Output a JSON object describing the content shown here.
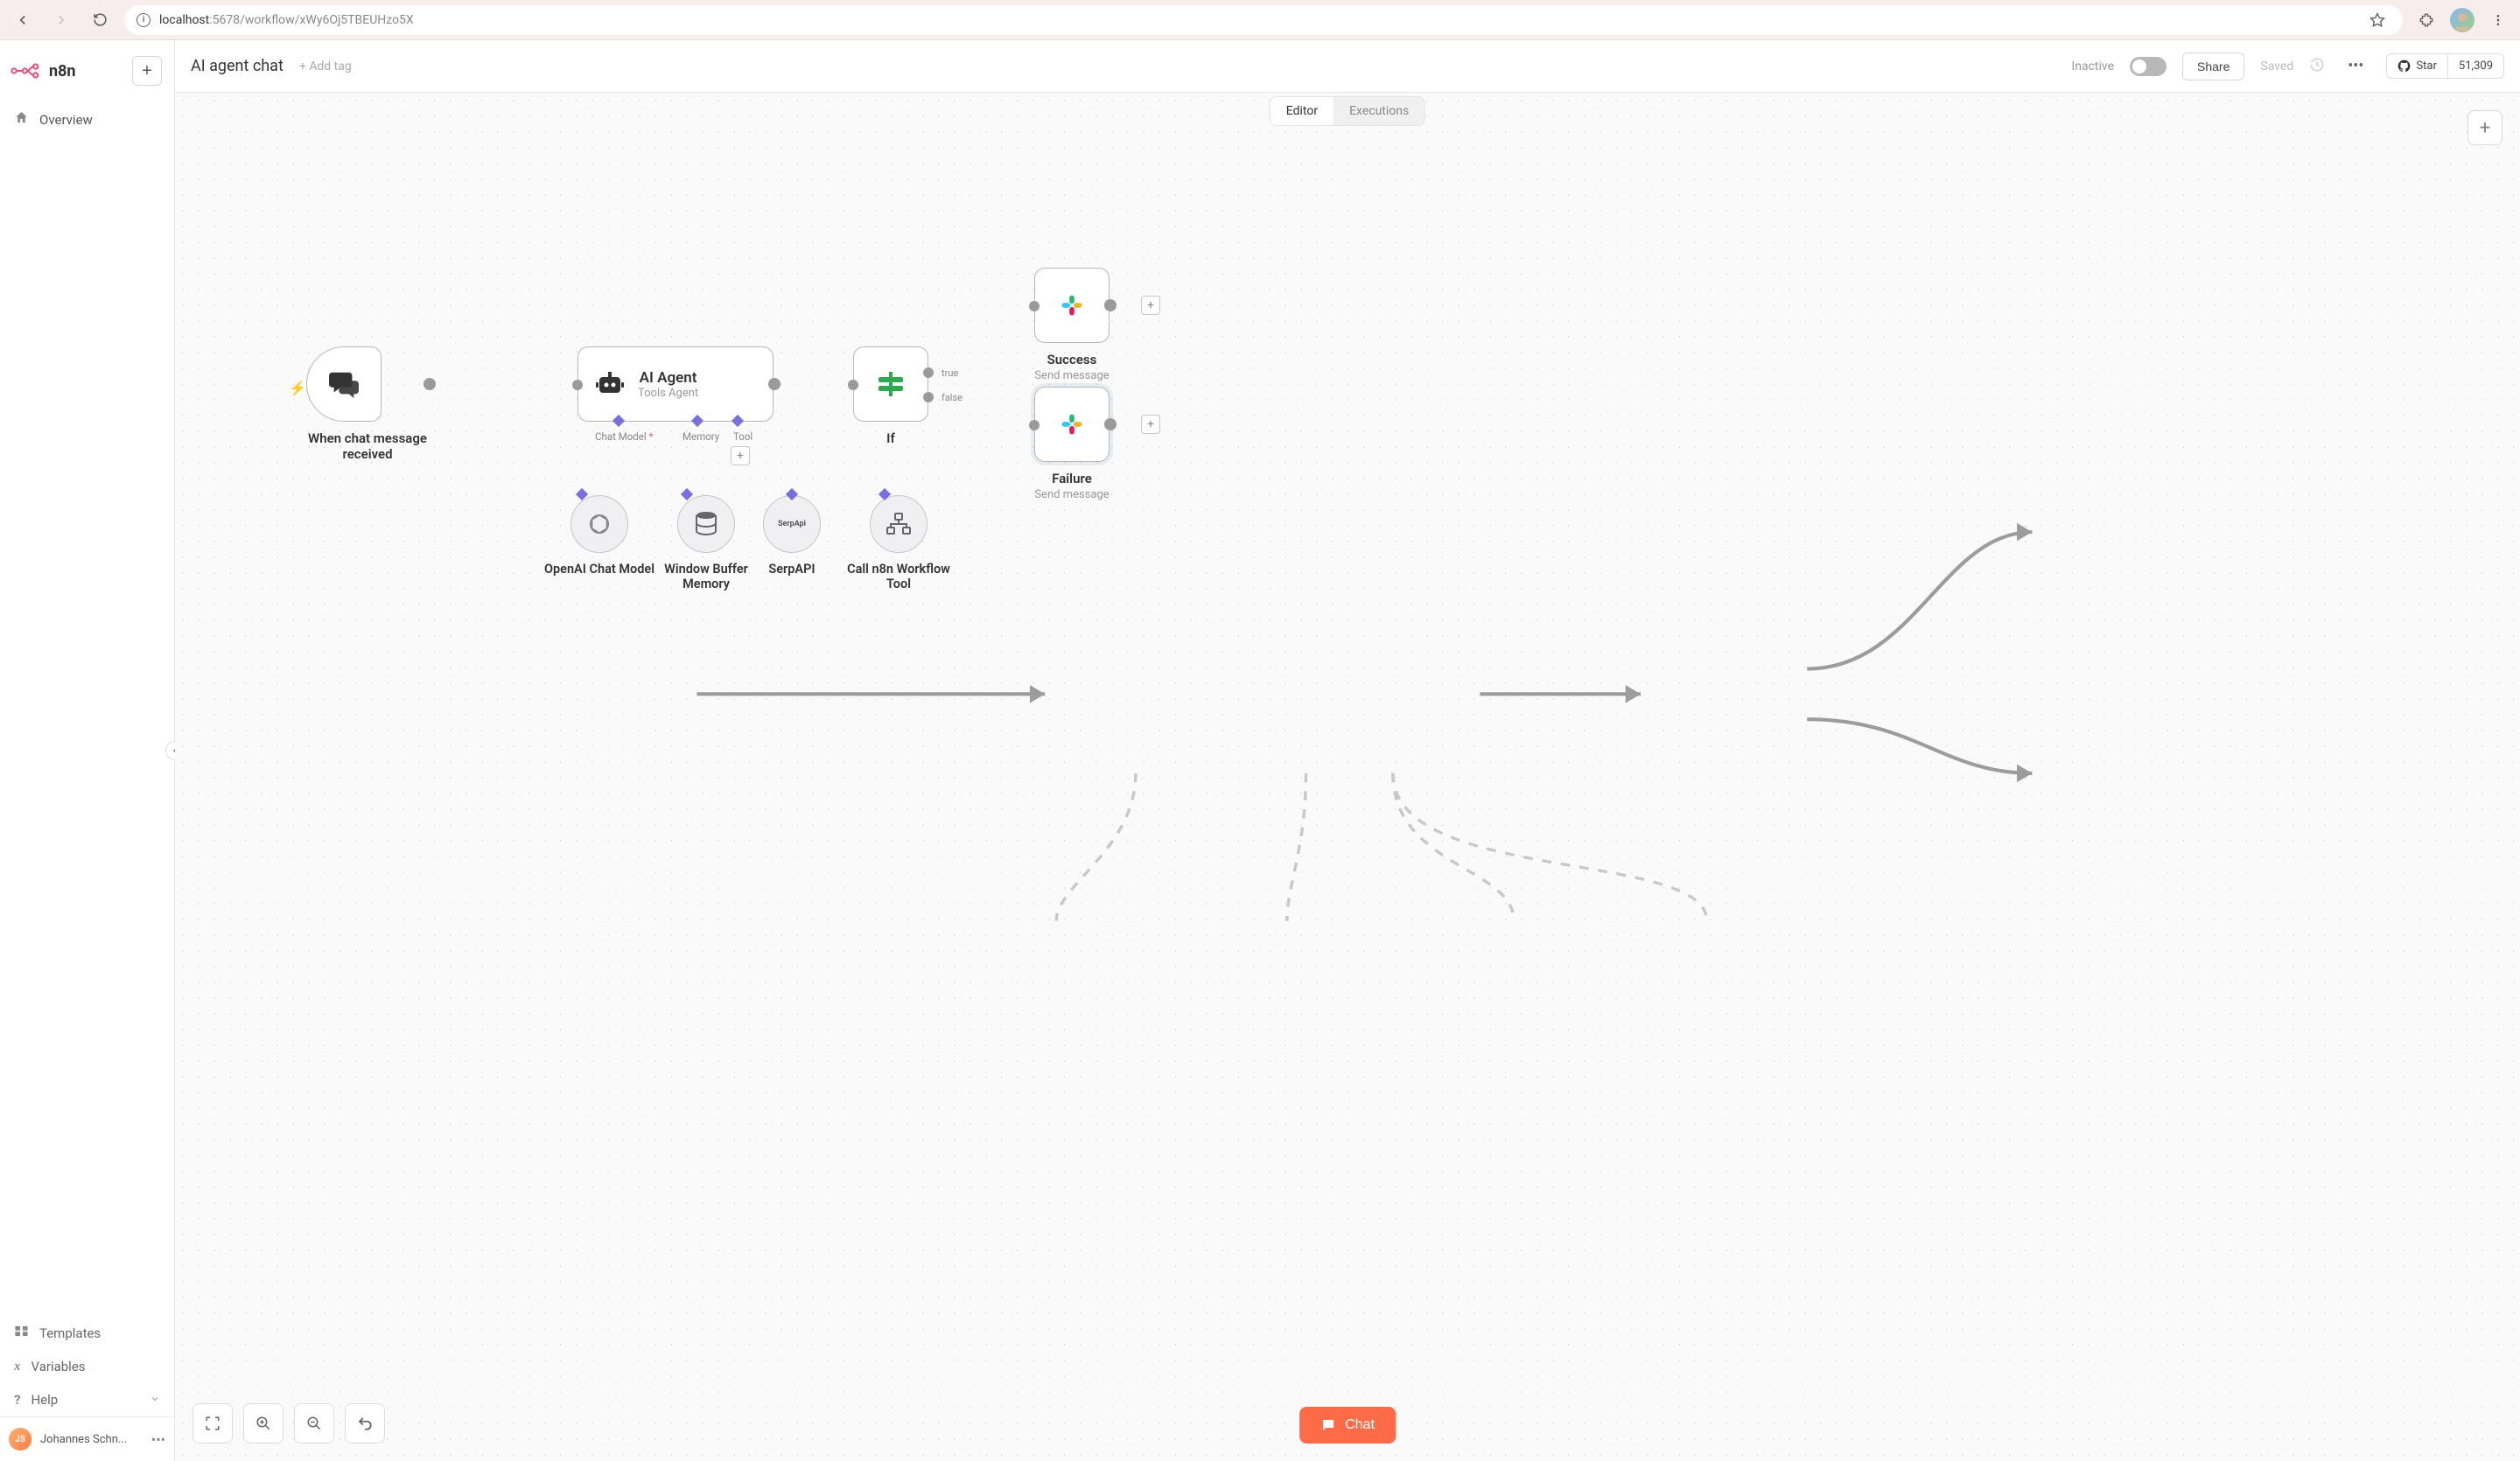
{
  "browser": {
    "url_host": "localhost",
    "url_rest": ":5678/workflow/xWy6Oj5TBEUHzo5X"
  },
  "brand": "n8n",
  "sidebar": {
    "overview": "Overview",
    "templates": "Templates",
    "variables": "Variables",
    "help": "Help",
    "user_initials": "JS",
    "user_name": "Johannes Schn..."
  },
  "topbar": {
    "title": "AI agent chat",
    "add_tag": "+ Add tag",
    "inactive": "Inactive",
    "share": "Share",
    "saved": "Saved",
    "star_label": "Star",
    "star_count": "51,309"
  },
  "tabs": {
    "editor": "Editor",
    "executions": "Executions"
  },
  "nodes": {
    "trigger": "When chat message received",
    "agent_title": "AI Agent",
    "agent_sub": "Tools Agent",
    "if": "If",
    "success_title": "Success",
    "success_sub": "Send message",
    "failure_title": "Failure",
    "failure_sub": "Send message",
    "chat_model": "Chat Model",
    "memory": "Memory",
    "tool": "Tool",
    "openai": "OpenAI Chat Model",
    "wbm": "Window Buffer Memory",
    "serp": "SerpAPI",
    "serp_badge": "SerpApi",
    "calltool": "Call n8n Workflow Tool",
    "true": "true",
    "false": "false"
  },
  "chat_button": "Chat"
}
